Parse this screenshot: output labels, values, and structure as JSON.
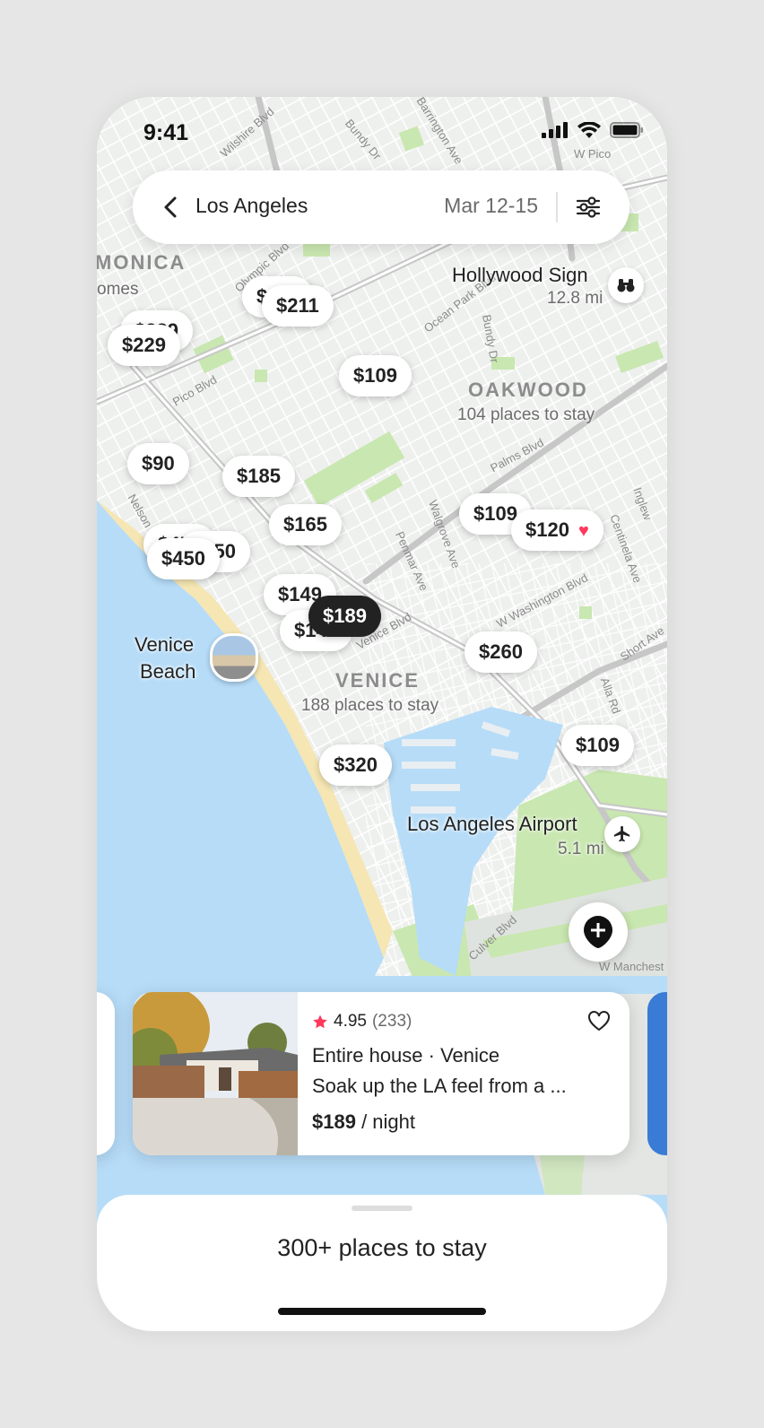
{
  "status": {
    "time": "9:41"
  },
  "search": {
    "city": "Los Angeles",
    "dates": "Mar 12-15"
  },
  "map": {
    "pins": {
      "p211": "$211",
      "p229": "$229",
      "p109a": "$109",
      "p90": "$90",
      "p185": "$185",
      "p165": "$165",
      "p109b": "$109",
      "p120": "$120",
      "p450": "$450",
      "p149": "$149",
      "p189": "$189",
      "p260": "$260",
      "p109c": "$109",
      "p320": "$320"
    },
    "places": {
      "hollywood": {
        "name": "Hollywood Sign",
        "distance": "12.8 mi"
      },
      "oakwood": {
        "name": "OAKWOOD",
        "count": "104 places to stay"
      },
      "venice": {
        "name": "VENICE",
        "count": "188 places to stay"
      },
      "venice_beach": {
        "line1": "Venice",
        "line2": "Beach"
      },
      "airport": {
        "name": "Los Angeles Airport",
        "distance": "5.1 mi"
      },
      "monica": "MONICA",
      "homes": "omes"
    },
    "streets": {
      "wilshire": "Wilshire Blvd",
      "bundy_top": "Bundy Dr",
      "barrington": "Barrington Ave",
      "olympic": "Olympic Blvd",
      "ocean_park": "Ocean Park Blvd",
      "bundy": "Bundy Dr",
      "pico": "Pico Blvd",
      "palms": "Palms Blvd",
      "walgrove": "Walgrove Ave",
      "penmar": "Penmar Ave",
      "washington": "W Washington Blvd",
      "venice_blvd": "Venice Blvd",
      "centinela": "Centinela Ave",
      "short": "Short Ave",
      "alla": "Alla Rd",
      "inglewood": "Inglew",
      "culver": "Culver Blvd",
      "manchester": "W Manchest",
      "wpico": "W Pico",
      "nelson": "Nelson"
    }
  },
  "card": {
    "rating": "4.95",
    "reviews": "(233)",
    "type": "Entire house · Venice",
    "description": "Soak up the LA feel from a ...",
    "price": "$189",
    "price_unit": " / night"
  },
  "sheet": {
    "title": "300+ places to stay"
  },
  "icons": {
    "back": "chevron-left-icon",
    "filter": "sliders-icon",
    "binoculars": "binoculars-icon",
    "plane": "airplane-icon",
    "add": "add-pin-icon",
    "star": "star-icon",
    "heart": "heart-icon"
  },
  "colors": {
    "accent": "#ff385c",
    "water": "#b6dcf8",
    "park": "#c9e7b0",
    "selected_pin": "#222222"
  }
}
